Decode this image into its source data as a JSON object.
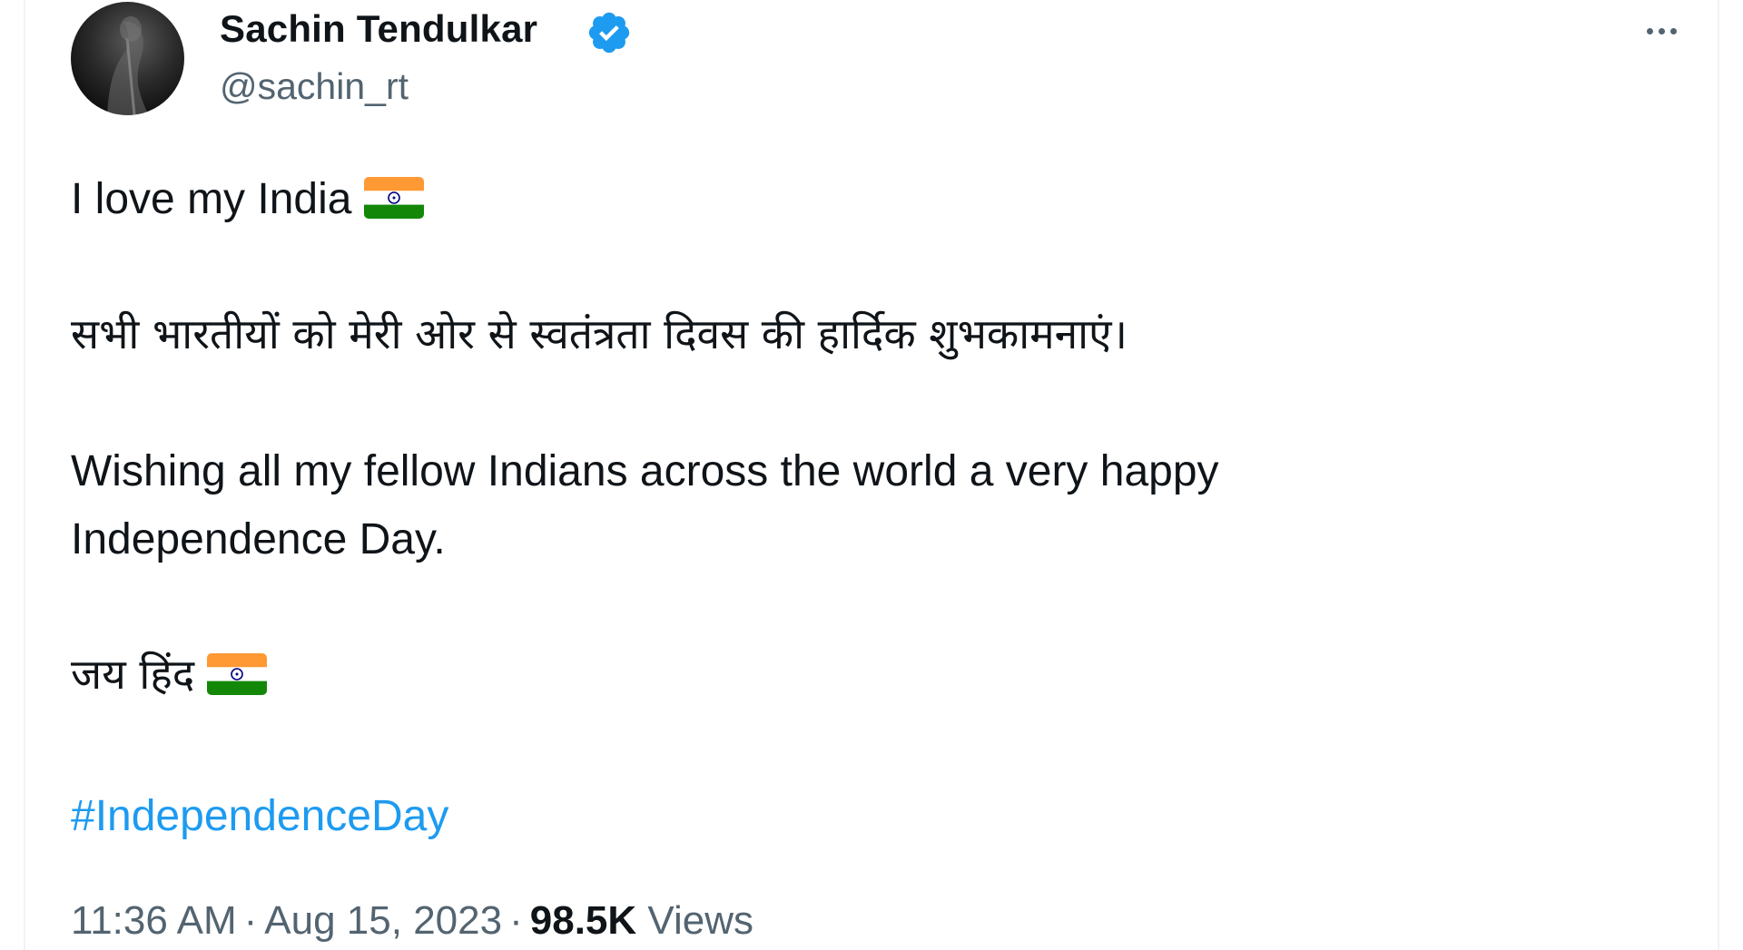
{
  "tweet": {
    "author_name": "Sachin Tendulkar",
    "handle": "@sachin_rt",
    "verified_icon": "verified-badge-icon",
    "more_icon": "more-options-icon",
    "lines": {
      "line1": "I love my India",
      "line2": "सभी भारतीयों को मेरी ओर से स्वतंत्रता दिवस की हार्दिक शुभकामनाएं।",
      "line3a": "Wishing all my fellow Indians across the world a very happy",
      "line3b": "Independence Day.",
      "line4": "जय हिंद"
    },
    "hashtag": "#IndependenceDay",
    "time": "11:36 AM",
    "date": "Aug 15, 2023",
    "separator": "·",
    "views_count": "98.5K",
    "views_label": "Views"
  },
  "colors": {
    "text": "#0f1419",
    "secondary": "#536471",
    "accent": "#1d9bf0",
    "flag_saffron": "#ff9933",
    "flag_green": "#138808",
    "flag_chakra": "#000080"
  }
}
